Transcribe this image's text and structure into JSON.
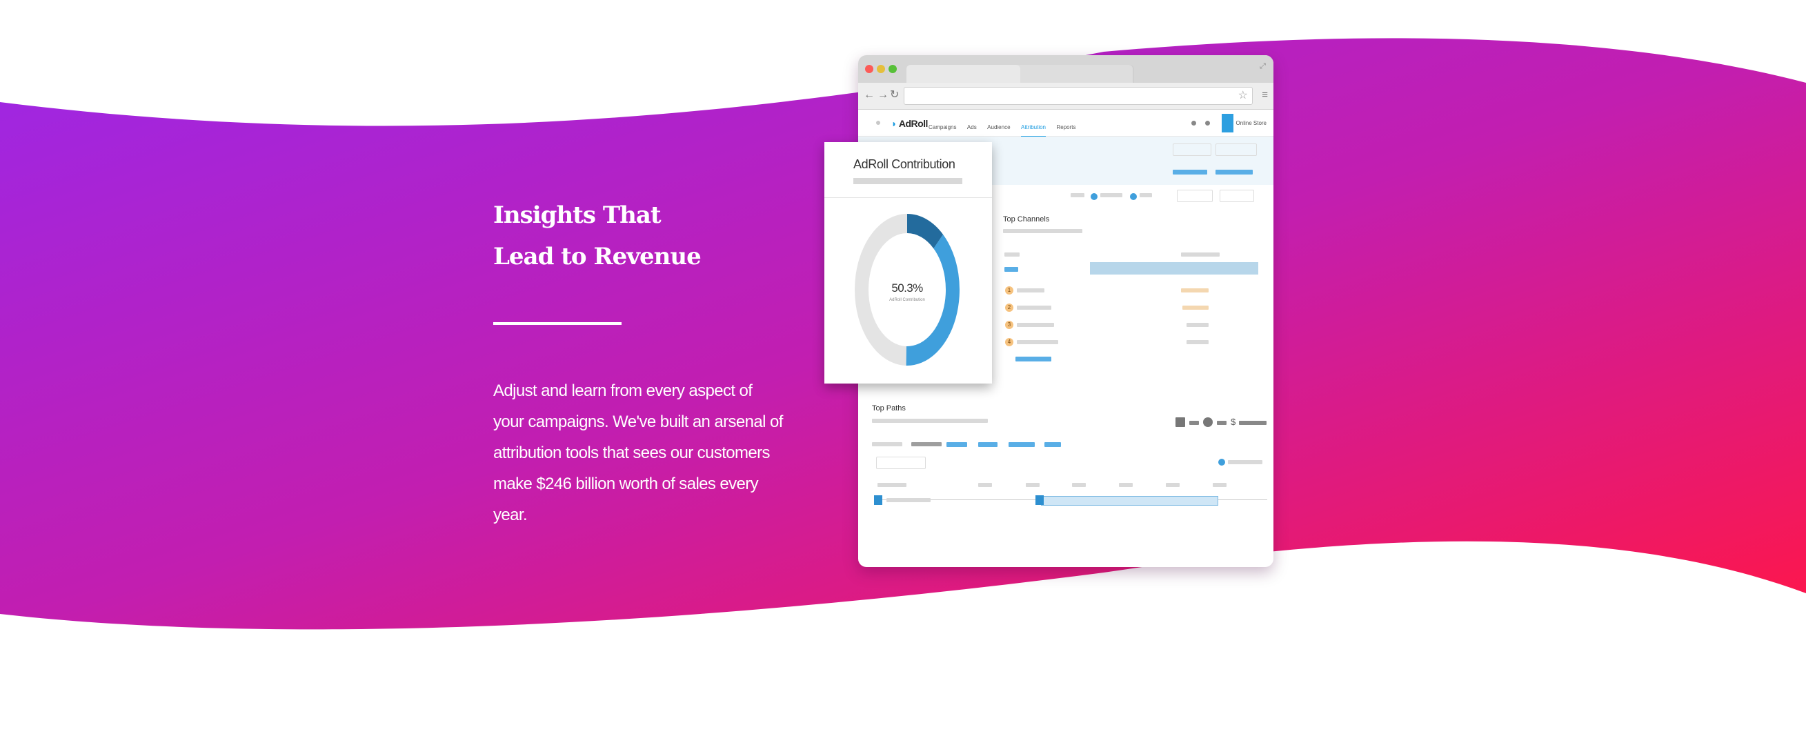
{
  "colors": {
    "gradient_start": "#9c27e6",
    "gradient_mid": "#c21eb0",
    "gradient_end": "#ff1648",
    "accent_blue": "#1a9be0",
    "donut_dark": "#236b9d",
    "donut_light": "#3f9fdc",
    "donut_rest": "#e4e4e4"
  },
  "section": {
    "heading_line1": "Insights That",
    "heading_line2": "Lead to Revenue",
    "description": "Adjust and learn from every aspect of your campaigns. We've built an arsenal of attribution tools that sees our customers make $246 billion worth of sales every year."
  },
  "browser": {
    "logo": "AdRoll",
    "nav": [
      "Campaigns",
      "Ads",
      "Audience",
      "Attribution",
      "Reports"
    ],
    "active_nav": "Attribution",
    "store_label": "Online Store",
    "top_channels_title": "Top Channels",
    "top_paths_title": "Top Paths",
    "ranks": [
      "1",
      "2",
      "3",
      "4"
    ],
    "currency_symbol": "$"
  },
  "contribution_card": {
    "title": "AdRoll Contribution",
    "value": "50.3%",
    "label": "AdRoll Contribution",
    "share_percent": 50.3,
    "dark_segment_percent": 12
  },
  "icons": [
    "back-arrow-icon",
    "forward-arrow-icon",
    "reload-icon",
    "bookmark-star-icon",
    "menu-icon",
    "expand-icon",
    "help-icon",
    "settings-icon"
  ]
}
